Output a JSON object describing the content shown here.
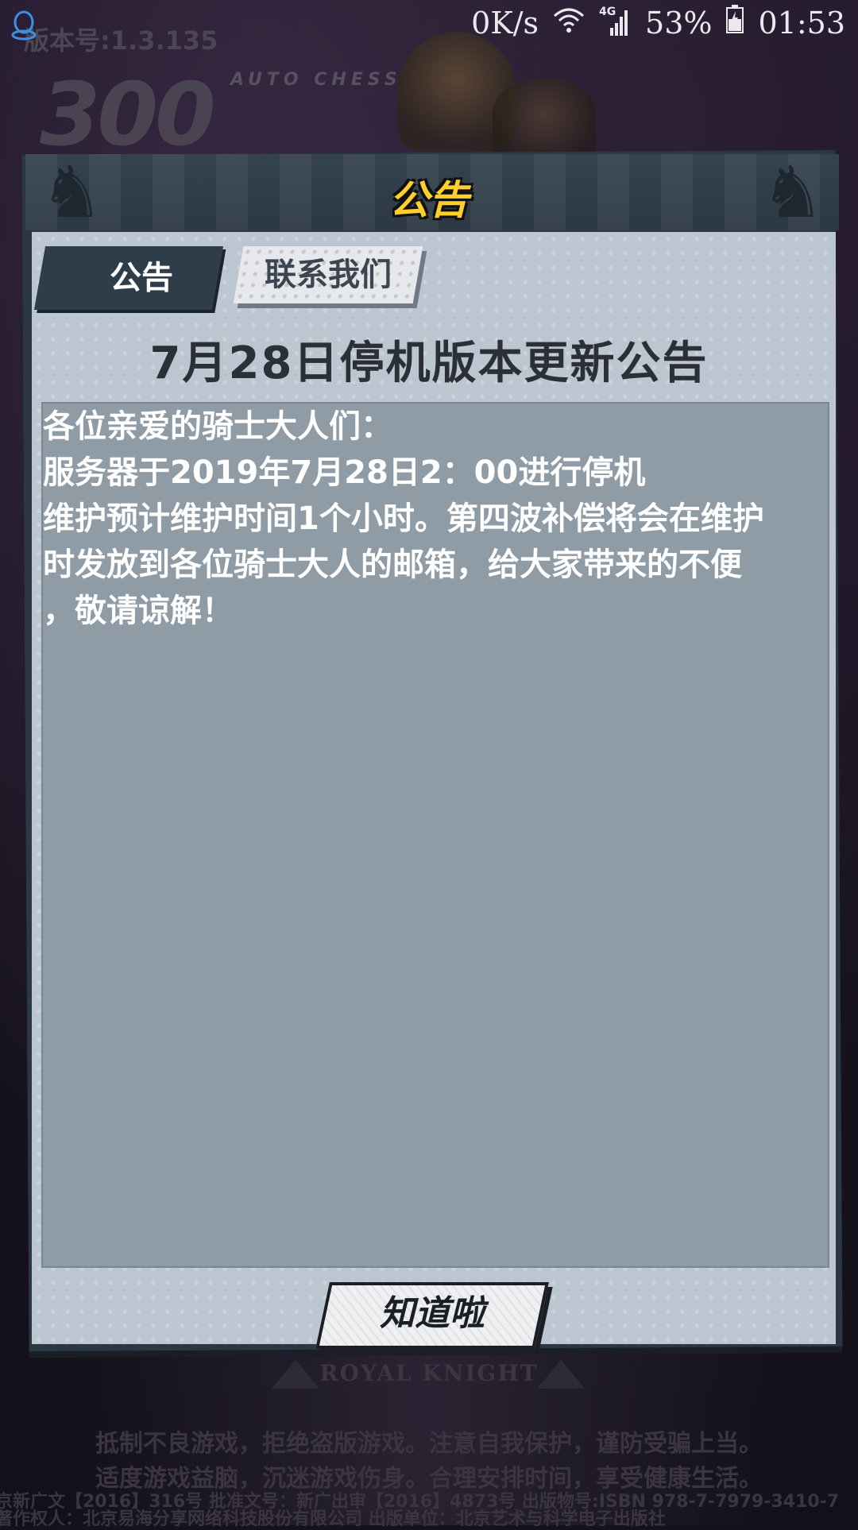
{
  "status_bar": {
    "net_speed": "0K/s",
    "network_label": "4G",
    "battery": "53%",
    "time": "01:53"
  },
  "background": {
    "version": "版本号:1.3.135",
    "logo_number": "300",
    "logo_subtitle": "AUTO CHESS",
    "royal_knight": "ROYAL KNIGHT",
    "footer_line1": "抵制不良游戏，拒绝盗版游戏。注意自我保护，谨防受骗上当。",
    "footer_line2": "适度游戏益脑，沉迷游戏伤身。合理安排时间，享受健康生活。",
    "footer_line3": "京新广文【2016】316号 批准文号：新广出审【2016】4873号 出版物号:ISBN 978-7-7979-3410-7",
    "footer_line4": "著作权人：北京易海分享网络科技股份有限公司 出版单位：北京艺术与科学电子出版社"
  },
  "dialog": {
    "title": "公告",
    "tabs": [
      {
        "label": "公告",
        "active": true
      },
      {
        "label": "联系我们",
        "active": false
      }
    ],
    "notice_title": "7月28日停机版本更新公告",
    "notice_lines": [
      "各位亲爱的骑士大人们：",
      "服务器于2019年7月28日2：00进行停机",
      "维护预计维护时间1个小时。第四波补偿将会在维护",
      "时发放到各位骑士大人的邮箱，给大家带来的不便",
      "，敬请谅解！"
    ],
    "confirm_button": "知道啦"
  },
  "colors": {
    "title_yellow": "#ffcf2a",
    "panel_dark": "#2b3744",
    "content_bg": "#8f9ba5",
    "inner_bg": "#bcc6d1"
  },
  "icons": [
    "qq-icon",
    "wifi-icon",
    "signal-icon",
    "battery-icon",
    "knight-icon"
  ]
}
